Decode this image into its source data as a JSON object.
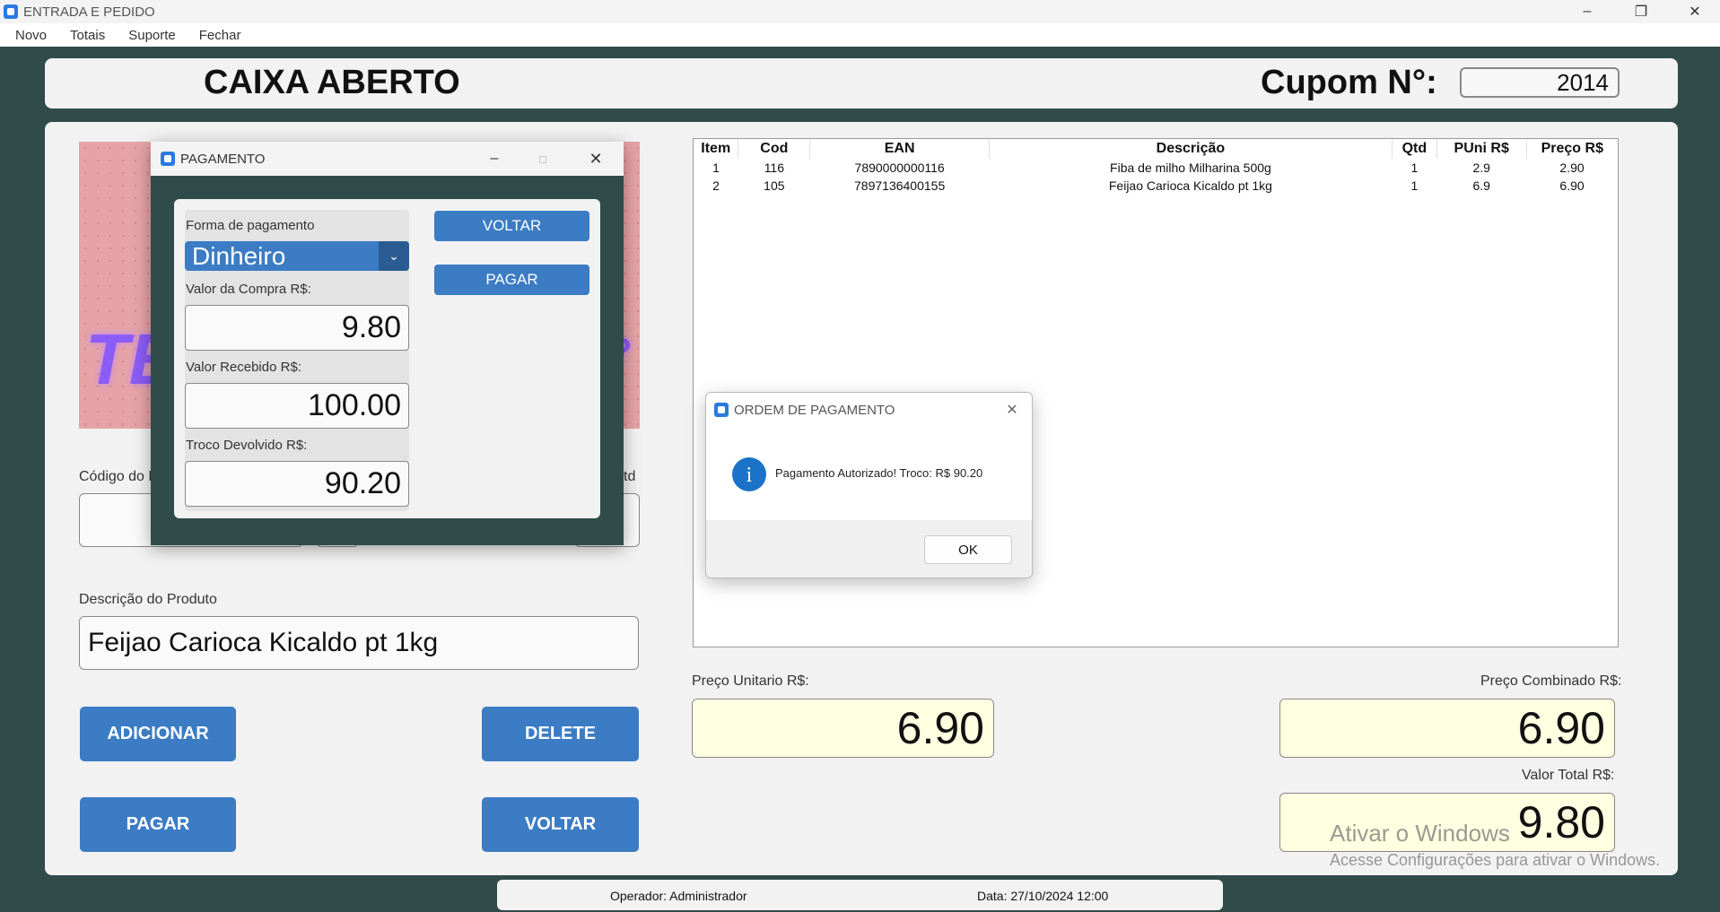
{
  "window": {
    "title": "ENTRADA E PEDIDO"
  },
  "menu": [
    "Novo",
    "Totais",
    "Suporte",
    "Fechar"
  ],
  "header": {
    "status": "CAIXA ABERTO",
    "cupom_label": "Cupom N°:",
    "cupom_value": "2014"
  },
  "form": {
    "codigo_label": "Código do P",
    "qtd_label": "td",
    "descricao_label": "Descrição do Produto",
    "descricao_value": "Feijao Carioca Kicaldo pt 1kg",
    "buttons": {
      "adicionar": "ADICIONAR",
      "delete": "DELETE",
      "pagar": "PAGAR",
      "voltar": "VOLTAR"
    }
  },
  "table": {
    "columns": [
      "Item",
      "Cod",
      "EAN",
      "Descrição",
      "Qtd",
      "PUni R$",
      "Preço R$"
    ],
    "rows": [
      [
        "1",
        "116",
        "7890000000116",
        "Fiba de milho Milharina 500g",
        "1",
        "2.9",
        "2.90"
      ],
      [
        "2",
        "105",
        "7897136400155",
        "Feijao Carioca Kicaldo pt 1kg",
        "1",
        "6.9",
        "6.90"
      ]
    ]
  },
  "prices": {
    "unitario_label": "Preço Unitario R$:",
    "unitario_value": "6.90",
    "combinado_label": "Preço Combinado R$:",
    "combinado_value": "6.90",
    "total_label": "Valor Total R$:",
    "total_value": "9.80"
  },
  "status": {
    "operador": "Operador: Administrador",
    "data": "Data: 27/10/2024 12:00"
  },
  "pagamento": {
    "title": "PAGAMENTO",
    "forma_label": "Forma de pagamento",
    "forma_value": "Dinheiro",
    "compra_label": "Valor da Compra R$:",
    "compra_value": "9.80",
    "recebido_label": "Valor Recebido R$:",
    "recebido_value": "100.00",
    "troco_label": "Troco Devolvido R$:",
    "troco_value": "90.20",
    "voltar": "VOLTAR",
    "pagar": "PAGAR"
  },
  "message": {
    "title": "ORDEM DE PAGAMENTO",
    "text": "Pagamento Autorizado! Troco: R$ 90.20",
    "ok": "OK"
  },
  "watermark": {
    "line1": "Ativar o Windows",
    "line2": "Acesse Configurações para ativar o Windows."
  },
  "colors": {
    "background": "#2f4b4a",
    "button_blue": "#3b7cc4",
    "price_bg": "#ffffe1"
  }
}
